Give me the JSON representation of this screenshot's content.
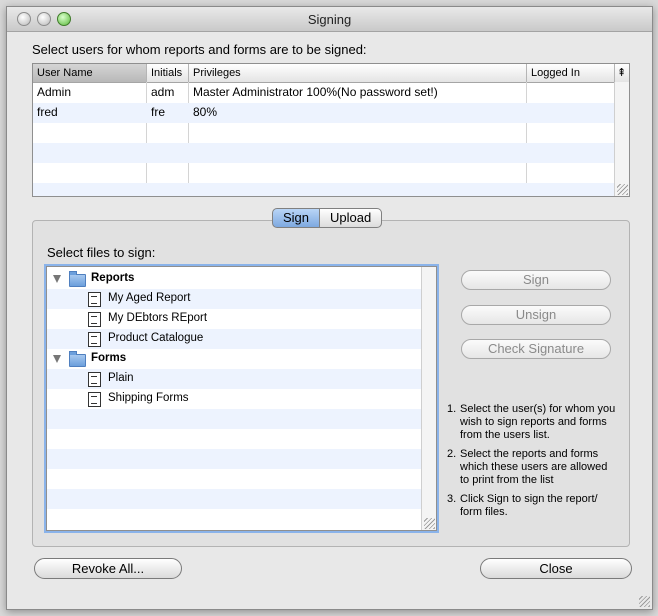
{
  "window": {
    "title": "Signing"
  },
  "users": {
    "instruction": "Select users for whom reports and forms are to be signed:",
    "columns": [
      "User Name",
      "Initials",
      "Privileges",
      "Logged In"
    ],
    "sort_icon": "⇞",
    "rows": [
      {
        "name": "Admin",
        "initials": "adm",
        "privileges": "Master Administrator 100%(No password set!)",
        "logged_in": ""
      },
      {
        "name": "fred",
        "initials": "fre",
        "privileges": "80%",
        "logged_in": ""
      }
    ]
  },
  "tabs": {
    "sign": "Sign",
    "upload": "Upload",
    "selected": "Sign"
  },
  "files": {
    "instruction": "Select files to sign:",
    "groups": [
      {
        "label": "Reports",
        "items": [
          "My Aged Report",
          "My DEbtors REport",
          "Product Catalogue"
        ]
      },
      {
        "label": "Forms",
        "items": [
          "Plain",
          "Shipping Forms"
        ]
      }
    ]
  },
  "actions": {
    "sign": "Sign",
    "unsign": "Unsign",
    "check_signature": "Check Signature"
  },
  "steps": [
    {
      "n": "1.",
      "text": "Select the user(s) for whom you wish to sign reports and forms from the users list."
    },
    {
      "n": "2.",
      "text": "Select the reports and forms which these users are allowed to print from the list"
    },
    {
      "n": "3.",
      "text": "Click Sign to sign the report/ form files."
    }
  ],
  "footer": {
    "revoke_all": "Revoke All...",
    "close": "Close"
  },
  "colors": {
    "row_alt": "#edf3fe",
    "selected_tab": "#7ea9e0",
    "focus_ring": "#8ab3ea"
  }
}
